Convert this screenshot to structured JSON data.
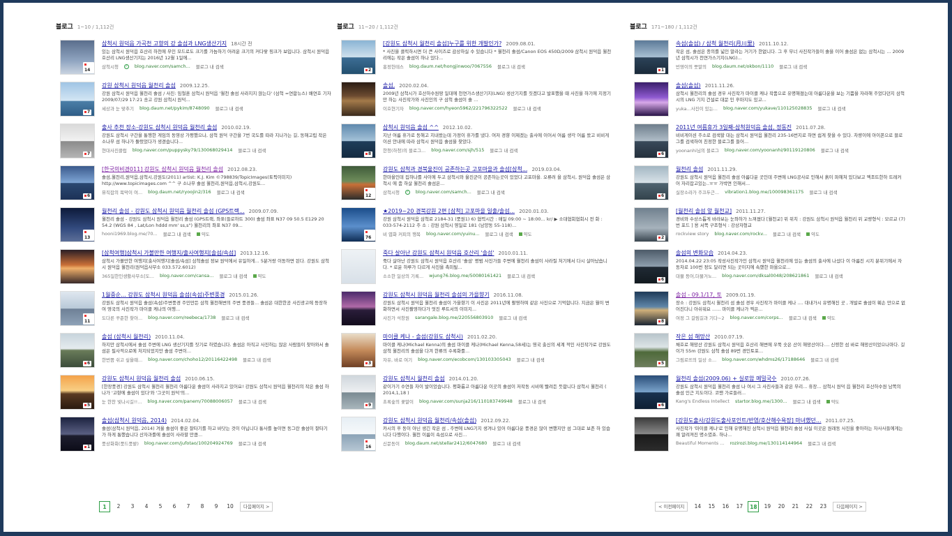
{
  "colors": {
    "title_link": "#1a1aa6",
    "visited_link": "#7b1fa2",
    "url": "#2e7d32",
    "current_page": "#2e9e46"
  },
  "columns": [
    {
      "header": {
        "title": "블로그",
        "range": "1~10 / 1,112건"
      },
      "items": [
        {
          "title": "삼척시 원덕읍 가곡천 고향의 강 솔섬과 LNG생산기지",
          "date": "18시간 전",
          "desc": "있는 삼척시 원덕읍 호산리 하천에 무인 모드로도 크기를 가늠하기 어려운 크기의 커다랗 핑크가 보입니다. 삼척시 원덕읍 호산리 LNG생산기지는 2016년 12월 1일에...",
          "source": "삼척시청",
          "url": "blog.naver.com/samch...",
          "search": "블로그 내 검색",
          "count": "14",
          "verified": true,
          "visited": false,
          "thumb": "linear-gradient(180deg,#5a6e8c 0%,#8fa4c0 60%,#c9d3e0 100%)"
        },
        {
          "title": "강원 삼척시 원덕읍 월천리 솔섬",
          "date": "2009.12.25.",
          "desc": "강원 삼척시 원덕읍 월천리 솔섬 / 사진: 임철훈 삼척시 원덕읍 '월천 솔섬 사라지지 않는다' (삼척 =연합뉴스) 배연호 기자 2009/07/29 17:21 송고 강원 삼척시 원덕...",
          "source": "세상과 눈 맞추기",
          "url": "blog.daum.net/pykim/8748090",
          "search": "블로그 내 검색",
          "count": "7",
          "verified": false,
          "visited": false,
          "thumb": "linear-gradient(180deg,#9fc4e4 0%,#d4e6f4 55%,#4c7fa8 56%,#2f5d86 100%)"
        },
        {
          "title": "출사 추천 장소-강원도 삼척시 원덕읍 월천리 솔섬",
          "date": "2010.02.19.",
          "desc": "강원도 삼척시 구간을 통행한 게임의 동영상 가평했으나, 삼척 원덕 구간을 7번 국도를 따라 지나가는 길, 동해고립 작은 소나무 섬 하나가 둘렀었다가 생겼습니다...",
          "source": "현대사진클럽",
          "url": "blog.naver.com/puppysky79/130068029414",
          "search": "블로그 내 검색",
          "count": "7",
          "verified": false,
          "visited": false,
          "thumb": "linear-gradient(180deg,#d9d9d9 0%,#f2f2f2 50%,#8a8a8a 51%,#b5b5b5 100%)"
        },
        {
          "title": "[한국의비경011] 강원도 삼척시 원덕읍 월천리 솔섬",
          "date": "2012.08.23.",
          "desc": "솔섬,월천리,원덕읍,삼척시,강원도(2011) artist: K.J. Kim ©798839/TopicImages(토픽이미지) http://www.topicimages.com ^^ 구 소나무 솔섬 월천리,원덕읍,삼척시,강원도...",
          "source": "뮤직잡의 목막이 여...",
          "url": "blog.daum.net/ryoojin2/316",
          "search": "블로그 내 검색",
          "count": "6",
          "verified": false,
          "visited": true,
          "thumb": "linear-gradient(180deg,#3b5a8c 0%,#7fa6d6 50%,#2b4872 51%,#1c3257 100%)"
        },
        {
          "title": "월천리 솔섬 - 강원도 삼척시 원덕읍 월천리 솔섬 (GPS트랙...",
          "date": "2009.07.09.",
          "desc": "월천리 솔섬 - 강원도 삼척시 원덕읍 월천리 솔섬 (GPS트랙, 좌표(들로하트 300) 솔섬 좌표 N37 09 50.5 E129 20 54.2 (WGS 84 , Lat/Lon hddd mm' ss,s\") 월천리의 좌표 N37 09...",
          "source": "hooni1969.blog.me/70...",
          "url": "",
          "search": "블로그 내 검색",
          "count": "13",
          "verified": false,
          "visited": false,
          "yak": "약도",
          "thumb": "linear-gradient(180deg,#0d1a3a 0%,#324a7e 60%,#5c6f98 100%)"
        },
        {
          "title": "[삼척여행]삼척시 가볼만한 여행지/출사여행지[솔섬/속섬]",
          "date": "2013.12.16.",
          "desc": "삼척시 가볼만한 여행지[출사여행지[솔섬/속섬] 삼척솔섬 정보 원덕에서 유일하게... 5분거랑 이동하면 된다. 강원도 삼척시 원덕읍 월천리(원덕읍사무소 033.572.6012)",
          "source": "365일한인생활사무소[도...",
          "url": "blog.naver.com/cansa...",
          "search": "블로그 내 검색",
          "count": "",
          "verified": false,
          "visited": false,
          "yak": "약도",
          "thumb": "linear-gradient(180deg,#2a1e25 0%,#c96f37 45%,#f0b06a 55%,#3a2a2a 100%)"
        },
        {
          "title": "1월중순... 강원도 삼척시 원덕읍 솔섬(속섬)주변풍경",
          "date": "2015.01.26.",
          "desc": "강원도 삼척시 원덕읍 솔섬(속섬)주변풍경 주민만든 삼척 월천해변의 주변 풍경들... 솔섬은 대한한공 사진광고에 등장하여 영국의 사진작가 마이클 케나의 여행...",
          "source": "도다른 꾸준한 찾아...",
          "url": "blog.naver.com/reebeca/1738",
          "search": "블로그 내 검색",
          "count": "11",
          "verified": false,
          "visited": false,
          "thumb": "linear-gradient(180deg,#dfe7ef 0%,#b9c9d8 50%,#6e8096 51%,#8ea2b7 100%)"
        },
        {
          "title": "솔섬 (삼척시 월천리)",
          "date": "2010.11.04.",
          "desc": "하지만 삼척시에서 솔섬 주변에 LNG 생산기지를 짓기로 하였습니다. 솔섬은 아직고 사진하는 많은 사람들이 찾아와서 솔섬은 필사적으로에 처지되었지만 솔섬 주변이...",
          "source": "한번쯤 쉬고 싶을때...",
          "url": "blog.naver.com/choho12/20116422498",
          "search": "블로그 내 검색",
          "count": "6",
          "verified": false,
          "visited": false,
          "thumb": "linear-gradient(180deg,#c7d4dc 0%,#e5ebee 45%,#6a7c5a 50%,#3b4c3a 100%)"
        },
        {
          "title": "강원도 삼척시 원덕읍 월천리 솔섬",
          "date": "2010.06.15.",
          "desc": "[한장풍경] 강원도 삼척시 월천리 월천리 아름다운 솔섬이 사라지고 있어요! 강원도 삼척시 원덕읍 월천리의 작은 솔섬 하나가 '고향에 솔섬이 있다'와 '그곳이 원덕'의...",
          "source": "눈 한찬 빛나시길!!...",
          "url": "blog.naver.com/panem/70088006057",
          "search": "블로그 내 검색",
          "count": "5",
          "verified": false,
          "visited": false,
          "thumb": "linear-gradient(180deg,#f4a24a 0%,#f8cf84 45%,#5a3a22 55%,#2a1a10 100%)"
        },
        {
          "title": "솔섬(삼척시 원덕읍, 2014)",
          "date": "2014.02.04.",
          "desc": "솔섬(삼척시 원덕읍, 2014) 겨울 솔섬이 좋은 잘타기를 하고 바닷는 것이 아닙니다 통사를 높이면 동그란 솔섬이 잘타기가 하게 통했습니다 산자과를에 솔섬이 사라할 만큼...",
          "source": "풍상화회(풍드풍밭)",
          "url": "blog.naver.com/jufotao/100204924769",
          "search": "블로그 내 검색",
          "count": "1",
          "verified": false,
          "visited": false,
          "thumb": "linear-gradient(180deg,#1c2340 0%,#5a5f82 50%,#1e1e2e 55%,#0c0c18 100%)"
        }
      ],
      "pager": {
        "pages": [
          "1",
          "2",
          "3",
          "4",
          "5",
          "6",
          "7",
          "8",
          "9",
          "10"
        ],
        "current": "1",
        "prev": "",
        "next": "다음페이지 >"
      }
    },
    {
      "header": {
        "title": "블로그",
        "range": "11~20 / 1,112건"
      },
      "items": [
        {
          "title": "[강원도 삼척시 월천리 솔섬]누구를 위한 개발인가?",
          "date": "2009.08.01.",
          "desc": "* 사진을 클릭하시면 더 큰 사이즈로 감상하실 수 있습니다 * 월천리 솔섬/Canon EOS 450D/2009 삼척시 원덕읍 월천리에는 작은 솔섬이 하나 있다...",
          "source": "홍정헌테스",
          "url": "blog.daum.net/hongjinwoo/7067556",
          "search": "블로그 내 검색",
          "count": "2",
          "verified": false,
          "visited": false,
          "thumb": "linear-gradient(180deg,#8ab4d4 0%,#cfe0ec 50%,#3d6d94 51%,#23506f 100%)"
        },
        {
          "title": "솔섬,",
          "date": "2020.02.04.",
          "desc": "2009년 삼척시가 호산하수원땅 일대에 천연가스생산기지(LNG) 생산기지를 짓겠다고 발표했을 때 사진을 하기에 지정기만 하는 사진작가와 사진인의 구 삼척 솔섬이 솔 ...",
          "source": "이호현기자",
          "url": "blog.naver.com/hyeon5962/221796322522",
          "search": "블로그 내 검색",
          "count": "",
          "verified": false,
          "visited": false,
          "thumb": "linear-gradient(180deg,#2b1d14 0%,#6b4a30 40%,#a37a4a 55%,#3b2a1c 100%)"
        },
        {
          "title": "삼척시 원덕읍 솔섬 ^^",
          "date": "2012.10.02.",
          "desc": "지난 여름 휴가로 동해고 지내왔는데 가정이 휴가를 냈다. 여저 경향 이제겠는 출사에 이어서 여름 생각 어름 왔고 비비게이션 안내에 따라 삼척시 원덕읍 솔섬을 찾았다.",
          "source": "한청(하청)의 블로그...",
          "url": "blog.naver.com/sjh/515",
          "search": "블로그 내 검색",
          "count": "8",
          "verified": false,
          "visited": false,
          "thumb": "linear-gradient(180deg,#5f89ad 0%,#a4c2d8 50%,#1f3d5a 51%,#132a40 100%)"
        },
        {
          "title": "강원도 삼척과 경북울진이 공존하는곳 고포마을과 솔섬[삼척...",
          "date": "2019.03.04.",
          "desc": "한마을인데 집하나를 사이에 두고 삼척시와 울진군이 공존하는곳이 있었다 고포마을. 오류려 을 삼척시, 원덕읍 솔섬은 삼척시 에 좀 하살 월천리 솔섬은...",
          "source": "삼척시청",
          "url": "blog.naver.com/samch...",
          "search": "블로그 내 검색",
          "count": "12",
          "verified": true,
          "visited": false,
          "thumb": "linear-gradient(180deg,#3f5b3a 0%,#6e8c5a 45%,#c96f37 55%,#2c2c2c 100%)"
        },
        {
          "title": "★2019~20 경북강원 2편 [삼척] 고포마을 일출/솔섬...",
          "date": "2020.01.03.",
          "desc": "강원 삼척시 원덕읍 삼척로 2184-31 (풍원1) 6) 협력시간 : 매일 09:00 ~ 18:00... kr/ ▶ 소대협회협회시 전 화 : 033-574-2112 주 소 : 강원 삼척시 영일로 181 (남양동 55-118)...",
          "source": "비 엽화 커피의 행복",
          "url": "blog.naver.com/yuinu...",
          "search": "블로그 내 검색",
          "count": "76",
          "verified": false,
          "visited": false,
          "yak": "약도",
          "thumb": "linear-gradient(180deg,#1b4d8a 0%,#5b8fcc 55%,#0f2d55 100%)"
        },
        {
          "title": "죽다 살아난 강원도 삼척시 원덕읍 호산리 '솔섬'",
          "date": "2010.01.11.",
          "desc": "죽다 살아난 강원도 삼척시 원덕읍 호산리 '솔섬' 평범 사진가들 주변에 월천리 솔섬이 사라질 처기에서 다시 살아났습니다. * 로운 하루가 다르게 사진을 촉미될...",
          "source": "소소한 일상의 기록...",
          "url": "wjung76.blog.me/50080161421",
          "search": "블로그 내 검색",
          "count": "",
          "verified": false,
          "visited": false,
          "thumb": "linear-gradient(180deg,#eef2f5 0%,#d8e0e8 100%)"
        },
        {
          "title": "강원도 삼척시 원덕읍 월천리 솔섬의 가을향기",
          "date": "2016.11.08.",
          "desc": "강원도 삼척시 원덕읍 월천리 솔섬이 가을향기 이 사진은 2011년에 촬영하며 같은 사진으로 기억합니다. 지금은 월이 변화하면서 사진촬영하다가 엇진 루트서의 이미지...",
          "source": "사진가 석창원",
          "url": "sarangale.blog.me/220556803910",
          "search": "블로그 내 검색",
          "count": "",
          "verified": false,
          "visited": false,
          "thumb": "linear-gradient(180deg,#4a2a6a 0%,#b06aa8 45%,#2a1d3a 55%,#120c1c 100%)"
        },
        {
          "title": "마이클 케나 - 솔섬(강원도 삼척시)",
          "date": "2011.02.20.",
          "desc": "마이클 케나(Michael Kenna)의 솔섬 마이클 케나(Michael Kenna,58세)는 영국 출신의 세계 적인 사진작가로 강원도 삼척 월천리의 솔섬을 다겨 한류의 수록화를...",
          "source": "자유, 바로 여기",
          "url": "blog.naver.com/ecobcom/130103305043",
          "search": "블로그 내 검색",
          "count": "3",
          "verified": false,
          "visited": false,
          "thumb": "linear-gradient(180deg,#e9dcc8 0%,#c48a5a 50%,#6e3f24 100%)"
        },
        {
          "title": "강원도 삼척시 월천리 솔섬",
          "date": "2014.01.20.",
          "desc": "같이가기 수연들 차이 발이었습니다. 평화롭고 아름다운 이곳의 솔섬이 저작동 시비에 빨려든 듯합니다 삼척시 월천리 ( 2014,1,18 )",
          "source": "초록숲의 꽃말이",
          "url": "blog.naver.com/sunja216/110183749948",
          "search": "블로그 내 검색",
          "count": "9",
          "verified": false,
          "visited": false,
          "thumb": "linear-gradient(180deg,#cfd6dc 0%,#eef0f2 50%,#7a8a92 51%,#a9b6bc 100%)"
        },
        {
          "title": "강원도 삼척시 원덕읍 월천리/속섬(솔섬)",
          "date": "2012.09.22.",
          "desc": "카시의 후 동이 아닌 생긴 작은 섬 , 주변에 LNG기지 생겨나 있어 아름다운 풍경은 많이 변했지만 섬 그대로 보존 하 있습니다 다행이다. 월천 이름이 속섬으로 사진...",
          "source": "신문동이",
          "url": "blog.daum.net/stellar2412/6047680",
          "search": "블로그 내 검색",
          "count": "16",
          "verified": false,
          "visited": false,
          "thumb": "linear-gradient(180deg,#e6eef4 0%,#f7f9fb 50%,#8aa2b6 51%,#b7c7d4 100%)"
        }
      ],
      "pager": {
        "pages": [],
        "current": "",
        "prev": "",
        "next": ""
      }
    },
    {
      "header": {
        "title": "블로그",
        "range": "171~180 / 1,112건"
      },
      "items": [
        {
          "title": "속섬(솔섬) / 삼척 월천리(月川里)",
          "date": "2011.10.12.",
          "desc": "작은 섬, 솔섬은 종의를 넓인 말라는 거기가 한없니다. 그 후 무너 사진작가들이 솔을 이어 솔섬은 없는 삼척시는 ... 2009년 삼척시가 천연가스기지(LNG)...",
          "source": "빈영이의 뭇말의",
          "url": "blog.daum.net/okbon/1110",
          "search": "블로그 내 검색",
          "count": "1",
          "verified": false,
          "visited": false,
          "thumb": "linear-gradient(180deg,#5c7a98 0%,#a9c0d3 50%,#2c4258 51%,#1a2a3a 100%)"
        },
        {
          "title": "솔섬(솔섬)",
          "date": "2011.11.26.",
          "desc": "삼척시 월천리의 솔섬 경우 사진작가 마이클 케나 작품으로 유명해졌는데 아름다운을 보는 기쁨을 자라해 주었다던지 삼척시의 LNG 기지 건설로 대문 인 후마지도 있고...",
          "source": "yuka...사진이 있는...",
          "url": "blog.naver.com/yukave/110125028835",
          "search": "블로그 내 검색",
          "count": "",
          "verified": false,
          "visited": false,
          "thumb": "linear-gradient(180deg,#3a1f6a 0%,#8e5ad0 45%,#d7a8e8 60%,#2a1448 100%)"
        },
        {
          "title": "2011년 여름휴가 3일째-삼척원덕읍 솔섬, 정동진",
          "date": "2011.07.28.",
          "desc": "비비게이션 주소로 검색할 대는 삼척시 원덕읍 월천리 235-16번지로 하면 쉽게 찾을 수 있다. 차량이에 아이폰으로 블로그를 검색하여 친정한 블로그를 들어...",
          "source": "yoonanhi님의 블로그",
          "url": "blog.naver.com/yoonanhi/90119120806",
          "search": "블로그 내 검색",
          "count": "6",
          "verified": false,
          "visited": false,
          "thumb": "linear-gradient(180deg,#6e7e8c 0%,#b0bdc8 50%,#39495a 51%,#24303c 100%)"
        },
        {
          "title": "월천리 솔섬",
          "date": "2011.11.29.",
          "desc": "강원도 삼척시 원덕읍 월천리 솔섬 아름다운 곳인데 주변에 LNG공사로 인해서 흙이 파헤쳐 있다보고 엑조트한하 트레커어 자리잡고있는..ㅠㅠ 가박면 인해서...",
          "source": "실장소라가 주끄두근...",
          "url": "vibration1.blog.me/100098361175",
          "search": "블로그 내 검색",
          "count": "6",
          "verified": false,
          "visited": false,
          "thumb": "linear-gradient(180deg,#a3b6c2 0%,#d8e2e8 50%,#4f6470 51%,#33434c 100%)"
        },
        {
          "title": "[월천리 솔섬 앞 월천교]",
          "date": "2011.11.27.",
          "desc": "경비와 수상스톱게 바라보는 눈좌하가 느껴졌다 [월천교] 위 위치 : 강원도 삼척시 원덕읍 월천리 위 교량형식 : 모르교 (7)번 포드 ] 용 서쪽 구조형식 : 강상자형교",
          "source": "rockview story",
          "url": "blog.naver.com/rockv...",
          "search": "블로그 내 검색",
          "count": "2",
          "verified": false,
          "visited": false,
          "yak": "약도",
          "thumb": "linear-gradient(180deg,#70808e 0%,#a6b2bc 60%,#3a4650 100%)"
        },
        {
          "title": "솔섬의 변화모습",
          "date": "2014.04.23.",
          "desc": "2014.04.22 23:05 작성사진작가인 삼척시 원덕읍 월천리에 있는 솔섬의 출사에 나섰다 이 아름진 시지 분위기에서 자동차로 100번 정도 달리면 되는 곳이지에 속했한 마을으로...",
          "source": "대물 등어,더물거노...",
          "url": "blog.naver.com/dksal0048/208621861",
          "search": "블로그 내 검색",
          "count": "6",
          "verified": false,
          "visited": false,
          "thumb": "linear-gradient(180deg,#4c5a68 0%,#90a0ae 50%,#202a34 51%,#121a20 100%)"
        },
        {
          "title": "솔섬 - 09.1/17, 토",
          "date": "2009.01.19.",
          "desc": "장소 : 강원도 삼척시 월천리 섬 솔섬 경우 사진작가 마이클 케나 .... 대내가시 유명해진 곳 , 개발로 솔섬이 훼손 만으로 없어진다니 아쉬워요 ...... 마이클 케나가 찍은...",
          "source": "여정 그 갈림길과 기다~2",
          "url": "blog.naver.com/corps...",
          "search": "블로그 내 검색",
          "count": "8",
          "verified": false,
          "visited": true,
          "yak": "약도",
          "thumb": "linear-gradient(180deg,#1e3a58 0%,#5f86a8 45%,#d0b07a 55%,#1a2432 100%)"
        },
        {
          "title": "작은 섬 해망산",
          "date": "2010.07.19.",
          "desc": "채호로 해망산 강원도 삼척시 원덕읍 호산리 해변에 우뚝 솟은 산이 해망산이다.... 신령한 섬 바로 해망산이었으나마다. 길이가 55m 강원도 삼척 솔섬 89번 경인토포...",
          "source": "그림로뜨의 일상 소...",
          "url": "blog.naver.com/whdms26/17188646",
          "search": "블로그 내 검색",
          "count": "5",
          "verified": false,
          "visited": false,
          "thumb": "linear-gradient(180deg,#b7c4ca 0%,#dce4e6 40%,#4e6a3a 55%,#6e7e5e 100%)"
        },
        {
          "title": "월천리 솔섬(2009.06) + 실로암 메밀국수",
          "date": "2010.07.26.",
          "desc": "강원도 삼척시 원덕읍 월천리 솔섬 나 여시 그 사진사들과 같은 무리... 휴장... 삼척시 원덕 읍 월천리 호산하수원 남쪽의 솔섬 인근 지도이다. 코맨 가로들러...",
          "source": "Kang's Endless Intellect",
          "url": "startor.blog.me/1300...",
          "search": "블로그 내 검색",
          "count": "6",
          "verified": false,
          "visited": false,
          "yak": "약도",
          "thumb": "linear-gradient(180deg,#2a4d78 0%,#7ba4cc 50%,#19324f 51%,#0e1f33 100%)"
        },
        {
          "title": "[강원도출사/강원도출사포인트/반영/호산해수욕장] 마녀했던...",
          "date": "2011.07.25.",
          "desc": "사진작가 '마이클 케나'로 인해 유명해진 삼척시 원덕읍 월천리 솔섬 사실 이곳은 원래동 사진을 좋아하는 자사사들에게는 꽤 알려져진 명소였죠. 하나...",
          "source": "Beautiful Moments ...",
          "url": "rozirozi.blog.me/130114144964",
          "search": "블로그 내 검색",
          "count": "",
          "verified": false,
          "visited": false,
          "thumb": "linear-gradient(180deg,#3a3a3a 0%,#8a8a8a 50%,#1a1a1a 51%,#2c2c2c 100%)"
        }
      ],
      "pager": {
        "pages": [
          "14",
          "15",
          "16",
          "17",
          "18",
          "19",
          "20",
          "21",
          "22",
          "23"
        ],
        "current": "18",
        "prev": "< 이전페이지",
        "next": "다음페이지 >"
      }
    }
  ]
}
